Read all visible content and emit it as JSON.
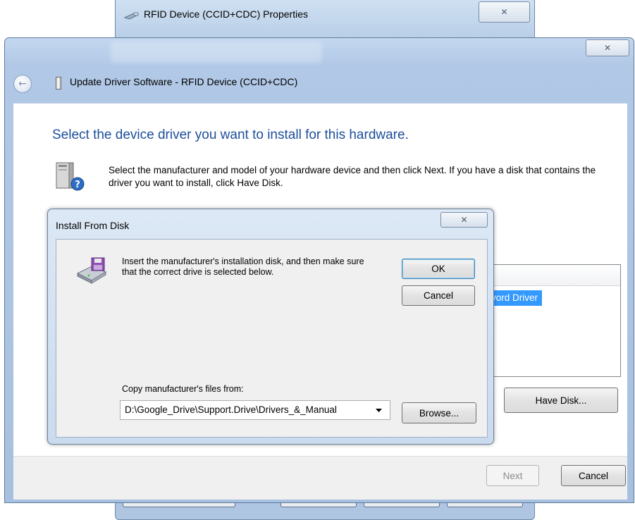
{
  "props_window": {
    "title": "RFID Device (CCID+CDC) Properties",
    "close_glyph": "✕"
  },
  "wizard": {
    "title": "Update Driver Software - RFID Device (CCID+CDC)",
    "close_glyph": "✕",
    "back_glyph": "←",
    "heading": "Select the device driver you want to install for this hardware.",
    "instructions": "Select the manufacturer and model of your hardware device and then click Next. If you have a disk that contains the driver you want to install, click Have Disk.",
    "model_selected": "vord Driver",
    "have_disk_label": "Have Disk...",
    "next_label": "Next",
    "cancel_label": "Cancel"
  },
  "install_from_disk": {
    "title": "Install From Disk",
    "close_glyph": "✕",
    "message": "Insert the manufacturer's installation disk, and then make sure that the correct drive is selected below.",
    "ok_label": "OK",
    "cancel_label": "Cancel",
    "copy_label": "Copy manufacturer's files from:",
    "path_value": "D:\\Google_Drive\\Support.Drive\\Drivers_&_Manual",
    "browse_label": "Browse..."
  },
  "icons": {
    "props": "usb-device-icon",
    "wizard": "device-icon",
    "hardware": "hardware-help-icon",
    "disk": "floppy-disk-icon"
  },
  "colors": {
    "heading": "#1e4f9c",
    "selection": "#3399ff"
  }
}
